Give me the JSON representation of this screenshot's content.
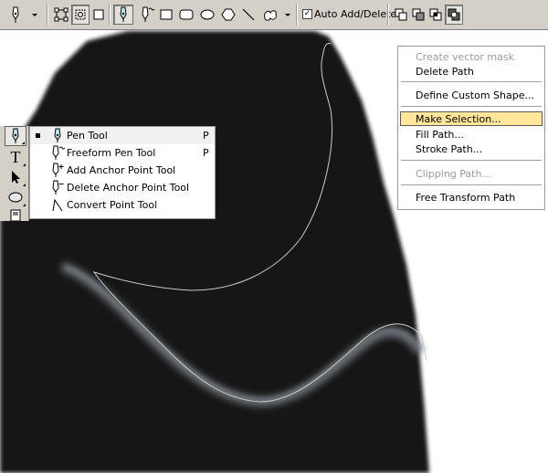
{
  "options_bar": {
    "tools": [
      {
        "name": "pen-tool-preset-icon"
      },
      {
        "name": "shape-layers-icon"
      },
      {
        "name": "paths-icon"
      },
      {
        "name": "fill-pixels-icon"
      },
      {
        "name": "pen-icon"
      },
      {
        "name": "freeform-pen-icon"
      },
      {
        "name": "rectangle-icon"
      },
      {
        "name": "rounded-rectangle-icon"
      },
      {
        "name": "ellipse-icon"
      },
      {
        "name": "polygon-icon"
      },
      {
        "name": "line-icon"
      },
      {
        "name": "custom-shape-icon"
      }
    ],
    "auto_add_delete": {
      "checked": true,
      "label": "Auto Add/Delete"
    },
    "path_ops": [
      "add-to-path-area-icon",
      "subtract-from-path-area-icon",
      "intersect-path-areas-icon",
      "exclude-overlapping-path-areas-icon"
    ]
  },
  "toolbox": {
    "tools": [
      {
        "name": "pen-tool-icon",
        "label": ""
      },
      {
        "name": "type-tool-icon",
        "label": "T"
      },
      {
        "name": "path-selection-icon",
        "label": ""
      },
      {
        "name": "ellipse-shape-icon",
        "label": ""
      },
      {
        "name": "notes-icon",
        "label": ""
      }
    ]
  },
  "flyout": {
    "items": [
      {
        "label": "Pen Tool",
        "shortcut": "P",
        "active": true,
        "icon": "pen-icon"
      },
      {
        "label": "Freeform Pen Tool",
        "shortcut": "P",
        "active": false,
        "icon": "freeform-pen-icon"
      },
      {
        "label": "Add Anchor Point Tool",
        "shortcut": "",
        "active": false,
        "icon": "add-anchor-point-icon"
      },
      {
        "label": "Delete Anchor Point Tool",
        "shortcut": "",
        "active": false,
        "icon": "delete-anchor-point-icon"
      },
      {
        "label": "Convert Point Tool",
        "shortcut": "",
        "active": false,
        "icon": "convert-point-icon"
      }
    ]
  },
  "context_menu": {
    "items": [
      {
        "label": "Create vector mask",
        "disabled": true
      },
      {
        "label": "Delete Path",
        "disabled": false
      },
      {
        "separator": true
      },
      {
        "label": "Define Custom Shape...",
        "disabled": false
      },
      {
        "separator": true
      },
      {
        "label": "Make Selection...",
        "disabled": false,
        "highlighted": true
      },
      {
        "label": "Fill Path...",
        "disabled": false
      },
      {
        "label": "Stroke Path...",
        "disabled": false
      },
      {
        "separator": true
      },
      {
        "label": "Clipping Path...",
        "disabled": true
      },
      {
        "separator": true
      },
      {
        "label": "Free Transform Path",
        "disabled": false
      }
    ]
  },
  "colors": {
    "toolbar_bg": "#d4d0c8",
    "shape_fill": "#141816",
    "menu_highlight": "#ffe69a",
    "path_stroke": "#c8cfc9"
  }
}
